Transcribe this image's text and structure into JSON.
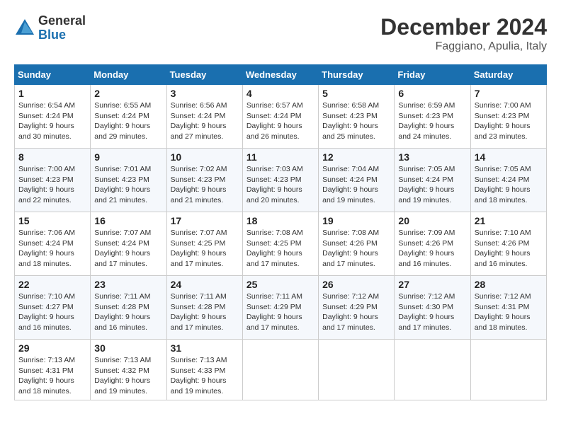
{
  "logo": {
    "general": "General",
    "blue": "Blue"
  },
  "title": "December 2024",
  "location": "Faggiano, Apulia, Italy",
  "weekdays": [
    "Sunday",
    "Monday",
    "Tuesday",
    "Wednesday",
    "Thursday",
    "Friday",
    "Saturday"
  ],
  "weeks": [
    [
      {
        "day": 1,
        "sunrise": "6:54 AM",
        "sunset": "4:24 PM",
        "daylight": "9 hours and 30 minutes."
      },
      {
        "day": 2,
        "sunrise": "6:55 AM",
        "sunset": "4:24 PM",
        "daylight": "9 hours and 29 minutes."
      },
      {
        "day": 3,
        "sunrise": "6:56 AM",
        "sunset": "4:24 PM",
        "daylight": "9 hours and 27 minutes."
      },
      {
        "day": 4,
        "sunrise": "6:57 AM",
        "sunset": "4:24 PM",
        "daylight": "9 hours and 26 minutes."
      },
      {
        "day": 5,
        "sunrise": "6:58 AM",
        "sunset": "4:23 PM",
        "daylight": "9 hours and 25 minutes."
      },
      {
        "day": 6,
        "sunrise": "6:59 AM",
        "sunset": "4:23 PM",
        "daylight": "9 hours and 24 minutes."
      },
      {
        "day": 7,
        "sunrise": "7:00 AM",
        "sunset": "4:23 PM",
        "daylight": "9 hours and 23 minutes."
      }
    ],
    [
      {
        "day": 8,
        "sunrise": "7:00 AM",
        "sunset": "4:23 PM",
        "daylight": "9 hours and 22 minutes."
      },
      {
        "day": 9,
        "sunrise": "7:01 AM",
        "sunset": "4:23 PM",
        "daylight": "9 hours and 21 minutes."
      },
      {
        "day": 10,
        "sunrise": "7:02 AM",
        "sunset": "4:23 PM",
        "daylight": "9 hours and 21 minutes."
      },
      {
        "day": 11,
        "sunrise": "7:03 AM",
        "sunset": "4:23 PM",
        "daylight": "9 hours and 20 minutes."
      },
      {
        "day": 12,
        "sunrise": "7:04 AM",
        "sunset": "4:24 PM",
        "daylight": "9 hours and 19 minutes."
      },
      {
        "day": 13,
        "sunrise": "7:05 AM",
        "sunset": "4:24 PM",
        "daylight": "9 hours and 19 minutes."
      },
      {
        "day": 14,
        "sunrise": "7:05 AM",
        "sunset": "4:24 PM",
        "daylight": "9 hours and 18 minutes."
      }
    ],
    [
      {
        "day": 15,
        "sunrise": "7:06 AM",
        "sunset": "4:24 PM",
        "daylight": "9 hours and 18 minutes."
      },
      {
        "day": 16,
        "sunrise": "7:07 AM",
        "sunset": "4:24 PM",
        "daylight": "9 hours and 17 minutes."
      },
      {
        "day": 17,
        "sunrise": "7:07 AM",
        "sunset": "4:25 PM",
        "daylight": "9 hours and 17 minutes."
      },
      {
        "day": 18,
        "sunrise": "7:08 AM",
        "sunset": "4:25 PM",
        "daylight": "9 hours and 17 minutes."
      },
      {
        "day": 19,
        "sunrise": "7:08 AM",
        "sunset": "4:26 PM",
        "daylight": "9 hours and 17 minutes."
      },
      {
        "day": 20,
        "sunrise": "7:09 AM",
        "sunset": "4:26 PM",
        "daylight": "9 hours and 16 minutes."
      },
      {
        "day": 21,
        "sunrise": "7:10 AM",
        "sunset": "4:26 PM",
        "daylight": "9 hours and 16 minutes."
      }
    ],
    [
      {
        "day": 22,
        "sunrise": "7:10 AM",
        "sunset": "4:27 PM",
        "daylight": "9 hours and 16 minutes."
      },
      {
        "day": 23,
        "sunrise": "7:11 AM",
        "sunset": "4:28 PM",
        "daylight": "9 hours and 16 minutes."
      },
      {
        "day": 24,
        "sunrise": "7:11 AM",
        "sunset": "4:28 PM",
        "daylight": "9 hours and 17 minutes."
      },
      {
        "day": 25,
        "sunrise": "7:11 AM",
        "sunset": "4:29 PM",
        "daylight": "9 hours and 17 minutes."
      },
      {
        "day": 26,
        "sunrise": "7:12 AM",
        "sunset": "4:29 PM",
        "daylight": "9 hours and 17 minutes."
      },
      {
        "day": 27,
        "sunrise": "7:12 AM",
        "sunset": "4:30 PM",
        "daylight": "9 hours and 17 minutes."
      },
      {
        "day": 28,
        "sunrise": "7:12 AM",
        "sunset": "4:31 PM",
        "daylight": "9 hours and 18 minutes."
      }
    ],
    [
      {
        "day": 29,
        "sunrise": "7:13 AM",
        "sunset": "4:31 PM",
        "daylight": "9 hours and 18 minutes."
      },
      {
        "day": 30,
        "sunrise": "7:13 AM",
        "sunset": "4:32 PM",
        "daylight": "9 hours and 19 minutes."
      },
      {
        "day": 31,
        "sunrise": "7:13 AM",
        "sunset": "4:33 PM",
        "daylight": "9 hours and 19 minutes."
      },
      null,
      null,
      null,
      null
    ]
  ]
}
